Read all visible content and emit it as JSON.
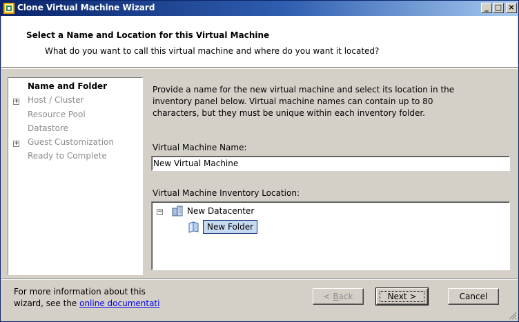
{
  "window": {
    "title": "Clone Virtual Machine Wizard",
    "controls": {
      "minimize": "_",
      "maximize": "□",
      "close": "×"
    }
  },
  "header": {
    "title": "Select a Name and Location for this Virtual Machine",
    "subtitle": "What do you want to call this virtual machine and where do you want it located?"
  },
  "steps": [
    {
      "label": "Name and Folder",
      "current": true,
      "expandable": false
    },
    {
      "label": "Host / Cluster",
      "current": false,
      "expandable": true
    },
    {
      "label": "Resource Pool",
      "current": false,
      "expandable": false
    },
    {
      "label": "Datastore",
      "current": false,
      "expandable": false
    },
    {
      "label": "Guest Customization",
      "current": false,
      "expandable": true
    },
    {
      "label": "Ready to Complete",
      "current": false,
      "expandable": false
    }
  ],
  "main": {
    "description_lines": [
      "Provide a name for the new virtual machine and select its location in the",
      "inventory panel below. Virtual machine names can contain up to 80",
      "characters, but they must be unique within each inventory folder."
    ],
    "name_label": "Virtual Machine Name:",
    "name_value": "New Virtual Machine",
    "location_label": "Virtual Machine Inventory Location:",
    "tree": {
      "datacenter": "New Datacenter",
      "folder": "New Folder"
    }
  },
  "footer": {
    "help_line1": "For more information about this",
    "help_line2_prefix": "wizard,  see the ",
    "help_link": "online documentati",
    "buttons": {
      "back_key": "B",
      "back_rest": "ack",
      "back_prefix": "< ",
      "next": "Next >",
      "cancel": "Cancel"
    }
  },
  "colors": {
    "titlebar_start": "#0a246a",
    "titlebar_end": "#a6caf0",
    "dialog_bg": "#d4d0c8",
    "selection_bg": "#c5d9f1",
    "link": "#0000ee",
    "disabled_text": "#8c8c8c"
  }
}
